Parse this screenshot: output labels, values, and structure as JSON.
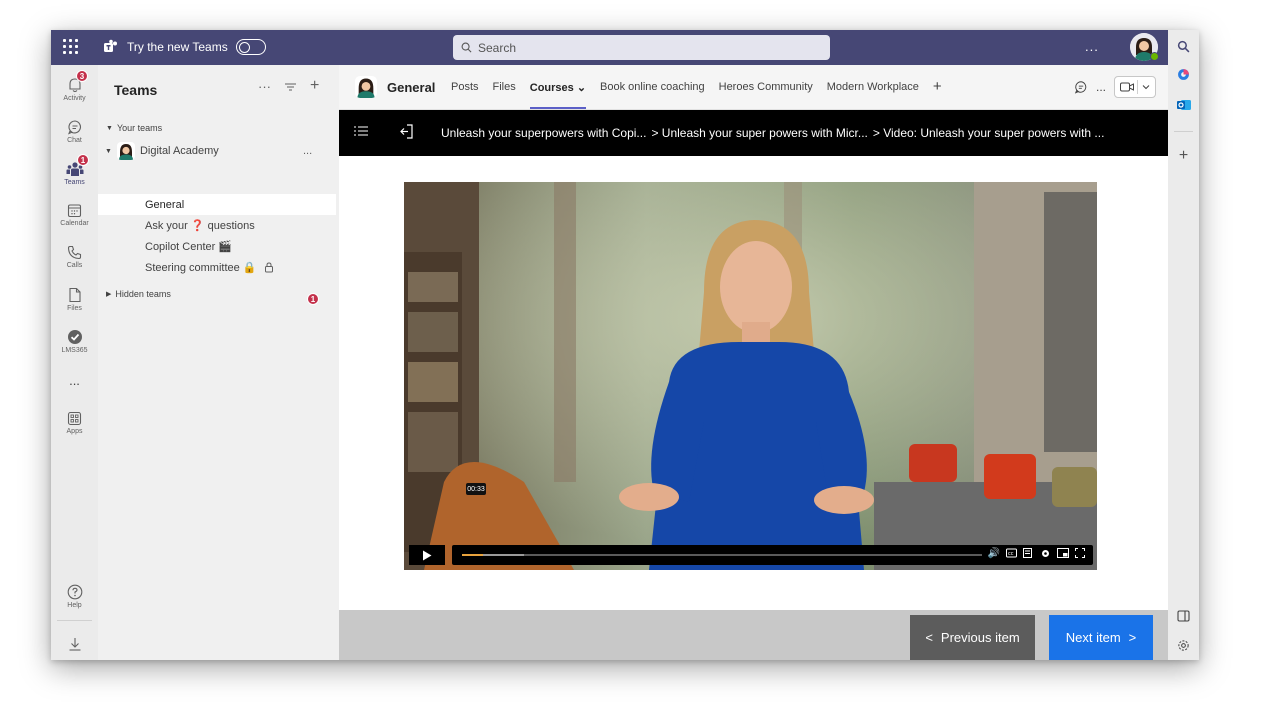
{
  "titlebar": {
    "try_new_label": "Try the new Teams",
    "search_placeholder": "Search",
    "more": "..."
  },
  "appbar": {
    "items": [
      {
        "label": "Activity",
        "badge": "3",
        "icon": "bell-icon"
      },
      {
        "label": "Chat",
        "badge": "",
        "icon": "chat-icon"
      },
      {
        "label": "Teams",
        "badge": "1",
        "icon": "teams-icon"
      },
      {
        "label": "Calendar",
        "badge": "",
        "icon": "calendar-icon"
      },
      {
        "label": "Calls",
        "badge": "",
        "icon": "phone-icon"
      },
      {
        "label": "Files",
        "badge": "",
        "icon": "file-icon"
      },
      {
        "label": "LMS365",
        "badge": "",
        "icon": "check-circle-icon"
      },
      {
        "label": "...",
        "badge": "",
        "icon": "more-icon"
      },
      {
        "label": "Apps",
        "badge": "",
        "icon": "apps-icon"
      }
    ],
    "help_label": "Help"
  },
  "teams_panel": {
    "title": "Teams",
    "your_teams_label": "Your teams",
    "team_name": "Digital Academy",
    "team_more": "...",
    "channels": [
      {
        "label": "General",
        "selected": true
      },
      {
        "label": "Ask your ❓ questions",
        "selected": false
      },
      {
        "label": "Copilot Center 🎬",
        "selected": false
      },
      {
        "label": "Steering committee 🔒",
        "selected": false
      }
    ],
    "hidden_teams_label": "Hidden teams",
    "hidden_teams_badge": "1"
  },
  "channel_header": {
    "name": "General",
    "tabs": [
      {
        "label": "Posts",
        "active": false
      },
      {
        "label": "Files",
        "active": false
      },
      {
        "label": "Courses ⌄",
        "active": true
      },
      {
        "label": "Book online coaching",
        "active": false
      },
      {
        "label": "Heroes Community",
        "active": false
      },
      {
        "label": "Modern Workplace",
        "active": false
      }
    ],
    "add_tab": "+",
    "more": "..."
  },
  "course_nav": {
    "breadcrumbs": [
      "Unleash your superpowers with Copi...",
      "> Unleash your super powers with Micr...",
      "> Video: Unleash your super powers with ..."
    ]
  },
  "video": {
    "current_time": "00:33",
    "progress": 0.04,
    "buffered": 0.12
  },
  "footer": {
    "prev_label": "Previous item",
    "next_label": "Next item"
  },
  "colors": {
    "titlebar": "#464775",
    "accent": "#5b5fc7",
    "next_button": "#1a73e8",
    "badge": "#c4314b",
    "presence": "#6bb700"
  }
}
